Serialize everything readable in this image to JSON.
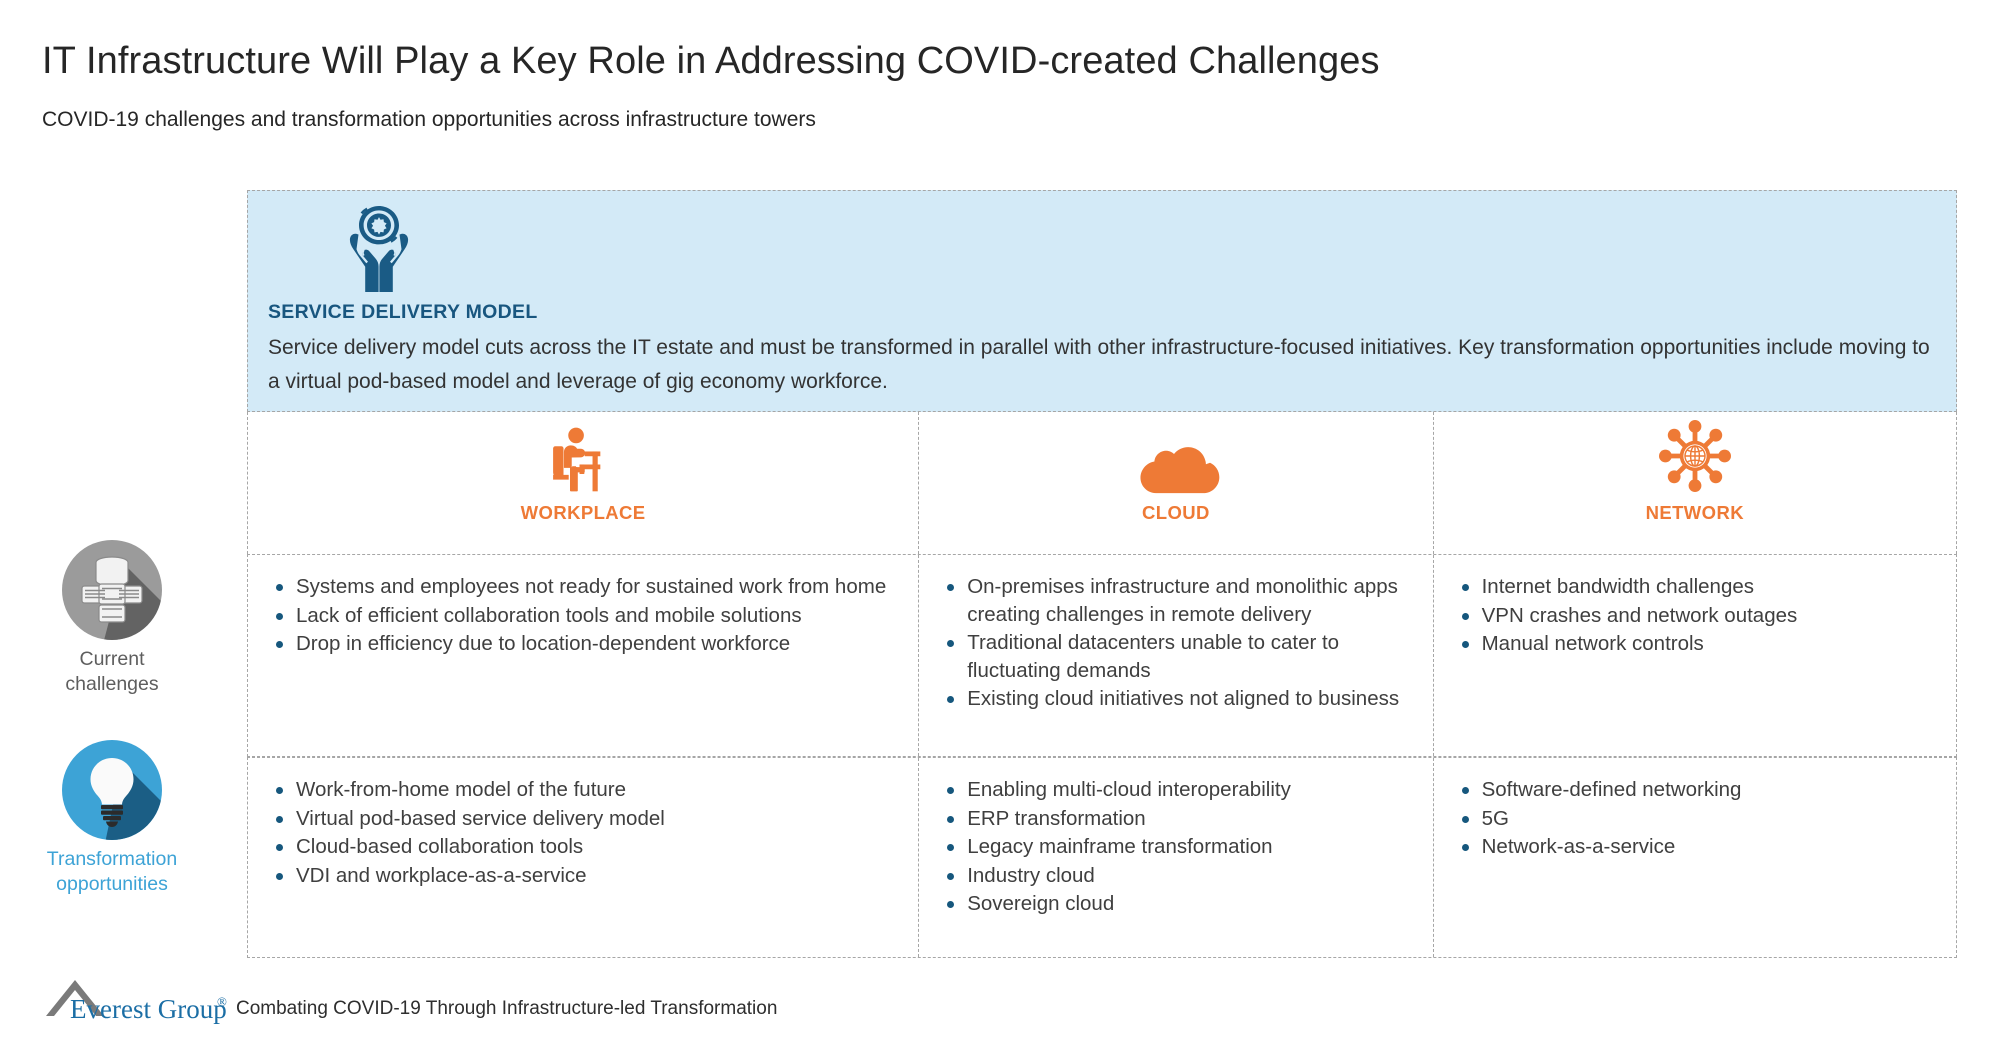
{
  "header": {
    "title": "IT Infrastructure Will Play a Key Role in Addressing COVID-created Challenges",
    "subtitle": "COVID-19 challenges and transformation opportunities across infrastructure towers"
  },
  "banner": {
    "icon": "hands-holding-gear-icon",
    "heading": "SERVICE DELIVERY MODEL",
    "body": "Service delivery model cuts across the IT estate and must be transformed in parallel with other infrastructure-focused initiatives. Key transformation opportunities include moving to a virtual pod-based model and leverage of gig economy workforce.",
    "background_color": "#d3eaf7",
    "heading_color": "#18567f"
  },
  "towers": [
    {
      "label": "WORKPLACE",
      "icon": "person-at-desk-icon"
    },
    {
      "label": "CLOUD",
      "icon": "cloud-icon"
    },
    {
      "label": "NETWORK",
      "icon": "network-globe-hub-icon"
    }
  ],
  "tower_color": "#ee7a36",
  "rail": [
    {
      "label_line1": "Current",
      "label_line2": "challenges",
      "icon": "server-stack-icon",
      "circle_color": "#9b9b9b",
      "shadow_color": "#4f4f4f",
      "text_color": "#5e5e5e"
    },
    {
      "label_line1": "Transformation",
      "label_line2": "opportunities",
      "icon": "lightbulb-icon",
      "circle_color": "#3da3d6",
      "shadow_color": "#1b5e85",
      "text_color": "#3da3d6"
    }
  ],
  "rows": {
    "challenges": {
      "workplace": [
        "Systems and employees not ready for sustained work from home",
        "Lack of efficient collaboration tools and mobile solutions",
        "Drop in efficiency due to location-dependent workforce"
      ],
      "cloud": [
        "On-premises infrastructure and monolithic apps creating challenges in remote delivery",
        "Traditional datacenters unable to cater to fluctuating demands",
        "Existing cloud initiatives not aligned to business"
      ],
      "network": [
        "Internet bandwidth challenges",
        "VPN crashes and network outages",
        "Manual network controls"
      ]
    },
    "opportunities": {
      "workplace": [
        "Work-from-home model of the future",
        "Virtual pod-based service delivery model",
        "Cloud-based collaboration tools",
        "VDI and workplace-as-a-service"
      ],
      "cloud": [
        "Enabling multi-cloud interoperability",
        "ERP transformation",
        "Legacy mainframe transformation",
        "Industry cloud",
        "Sovereign cloud"
      ],
      "network": [
        "Software-defined networking",
        "5G",
        "Network-as-a-service"
      ]
    }
  },
  "bullet_color": "#16577d",
  "footer": {
    "logo_name": "Everest Group",
    "logo_mark": "mountain-peak-icon",
    "registered_mark": "®",
    "text": "Combating COVID-19 Through Infrastructure-led Transformation",
    "logo_color": "#1b6ea5"
  }
}
